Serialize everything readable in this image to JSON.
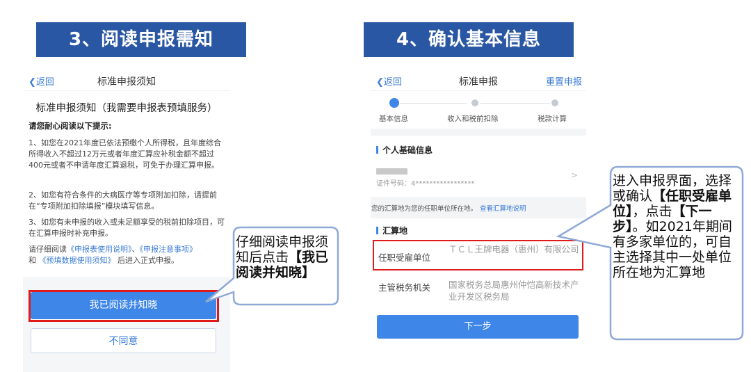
{
  "steps": {
    "left_title": "3、阅读申报需知",
    "right_title": "4、确认基本信息"
  },
  "left_screen": {
    "back_label": "返回",
    "nav_title": "标准申报须知",
    "notice_title": "标准申报须知（我需要申报表预填服务）",
    "subhead": "请您耐心阅读以下提示:",
    "paragraphs": [
      "1、如您在2021年度已依法预缴个人所得税，且年度综合所得收入不超过12万元或者年度汇算应补税金额不超过400元或者不申请年度汇算退税，可免于办理汇算申报。",
      "2、如您有符合条件的大病医疗等专项附加扣除，请提前在“专项附加扣除填报”模块填写信息。",
      "3、如您有未申报的收入或未足额享受的税前扣除项目，可在汇算申报时补充申报。"
    ],
    "read_prefix": "请仔细阅读",
    "link1": "《申报表使用说明》",
    "sep": "、",
    "link2": "《申报注意事项》",
    "and": "和",
    "link3": "《预填数据使用须知》",
    "read_suffix": "后进入正式申报。",
    "agree_button": "我已阅读并知晓",
    "disagree_button": "不同意"
  },
  "right_screen": {
    "back_label": "返回",
    "nav_title": "标准申报",
    "reset_label": "重置申报",
    "steps": [
      "基本信息",
      "收入和税前扣除",
      "税款计算"
    ],
    "section1_title": "个人基础信息",
    "id_line": "证件号码：4*****************",
    "note_text": "您的汇算地为您的任职单位所在地。",
    "note_link": "查看汇算地说明",
    "section2_title": "汇算地",
    "employer_label": "任职受雇单位",
    "employer_value": "ＴＣＬ王牌电器（惠州）有限公司",
    "tax_office_label": "主管税务机关",
    "tax_office_value": "国家税务总局惠州仲恺高新技术产业开发区税务局",
    "next_button": "下一步"
  },
  "callouts": {
    "left_line1": "仔细阅读申报须知后点击",
    "left_bold": "【我已阅读并知晓】",
    "right_a": "进入申报界面，选择或确认",
    "right_b_bold": "【任职受雇单位】",
    "right_c": "，点击",
    "right_d_bold": "【下一步】",
    "right_e": "。如2021年期间有多家单位的，可自主选择其中一处单位所在地为汇算地"
  },
  "colors": {
    "header_blue": "#2a57a3",
    "button_blue": "#3e86e8",
    "link_blue": "#3a7bd5",
    "highlight_red": "#e01a1a",
    "callout_border": "#8fa9d6"
  }
}
